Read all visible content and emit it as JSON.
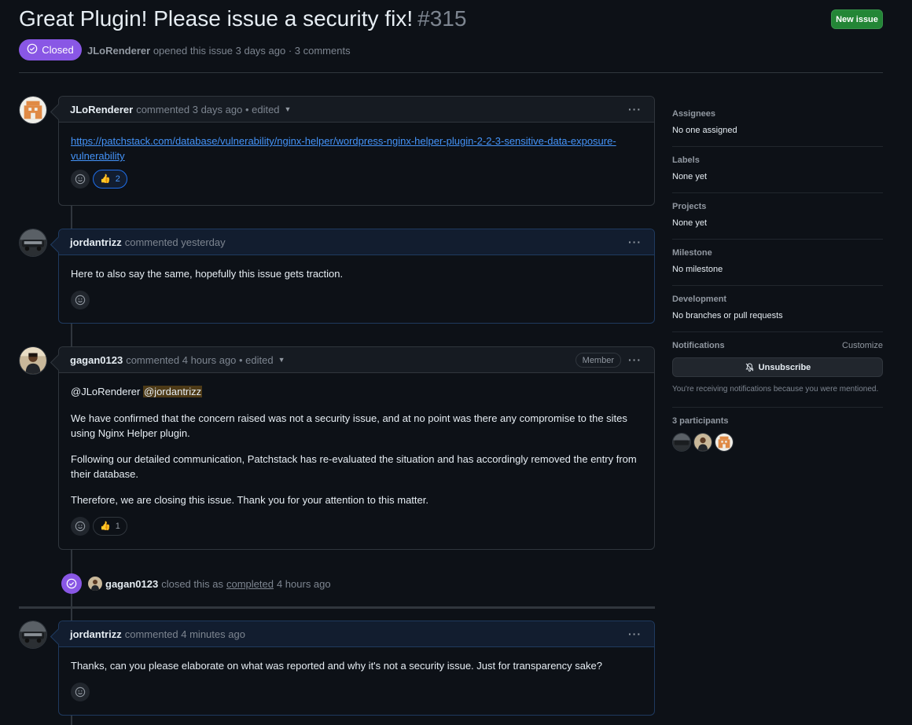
{
  "issue": {
    "title": "Great Plugin! Please issue a security fix!",
    "number": "#315",
    "state": "Closed",
    "author": "JLoRenderer",
    "opened_text": "opened this issue 3 days ago · 3 comments",
    "new_issue_label": "New issue"
  },
  "comments": [
    {
      "author": "JLoRenderer",
      "meta": "commented 3 days ago • edited",
      "link": "https://patchstack.com/database/vulnerability/nginx-helper/wordpress-nginx-helper-plugin-2-2-3-sensitive-data-exposure-vulnerability",
      "link_line1": "https://patchstack.com/database/vulnerability/nginx-helper/wordpress-nginx-helper-plugin-2-2-3-sensitive-data-exposure-",
      "link_line2": "vulnerability",
      "reaction_count": "2"
    },
    {
      "author": "jordantrizz",
      "meta": "commented yesterday",
      "body": "Here to also say the same, hopefully this issue gets traction."
    },
    {
      "author": "gagan0123",
      "meta": "commented 4 hours ago • edited",
      "badge": "Member",
      "mention1": "@JLoRenderer",
      "mention2": "@jordantrizz",
      "para1": "We have confirmed that the concern raised was not a security issue, and at no point was there any compromise to the sites using Nginx Helper plugin.",
      "para2": "Following our detailed communication, Patchstack has re-evaluated the situation and has accordingly removed the entry from their database.",
      "para3": "Therefore, we are closing this issue. Thank you for your attention to this matter.",
      "reaction_count": "1"
    },
    {
      "author": "jordantrizz",
      "meta": "commented 4 minutes ago",
      "body": "Thanks, can you please elaborate on what was reported and why it's not a security issue. Just for transparency sake?"
    }
  ],
  "close_event": {
    "actor": "gagan0123",
    "text_before": "closed this as",
    "link": "completed",
    "text_after": "4 hours ago"
  },
  "sidebar": {
    "assignees": {
      "heading": "Assignees",
      "value": "No one assigned"
    },
    "labels": {
      "heading": "Labels",
      "value": "None yet"
    },
    "projects": {
      "heading": "Projects",
      "value": "None yet"
    },
    "milestone": {
      "heading": "Milestone",
      "value": "No milestone"
    },
    "development": {
      "heading": "Development",
      "value": "No branches or pull requests"
    },
    "notifications": {
      "heading": "Notifications",
      "customize": "Customize",
      "button": "Unsubscribe",
      "reason": "You're receiving notifications because you were mentioned."
    },
    "participants": {
      "heading": "3 participants"
    }
  },
  "colors": {
    "closed_purple": "#8957e5",
    "new_issue_green": "#238636",
    "link_blue": "#4493f8",
    "mention_highlight": "#4d3a17"
  }
}
